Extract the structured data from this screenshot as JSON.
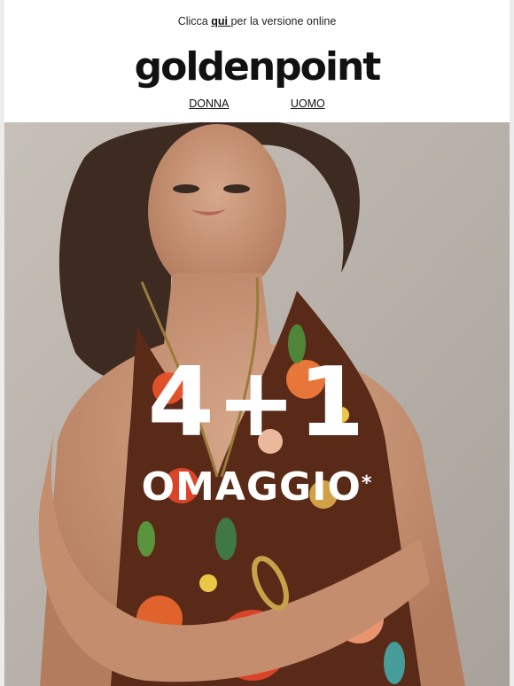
{
  "preheader": {
    "before": "Clicca ",
    "link": "qui ",
    "after": "per la versione online"
  },
  "brand": {
    "logo": "goldenpoint"
  },
  "nav": {
    "items": [
      "DONNA",
      "UOMO"
    ]
  },
  "hero": {
    "headline": "4+1",
    "subline": "OMAGGIO",
    "asterisk": "*"
  },
  "colors": {
    "background": "#ffffff",
    "hero_bg": "#b9b3ac",
    "text": "#111111"
  }
}
